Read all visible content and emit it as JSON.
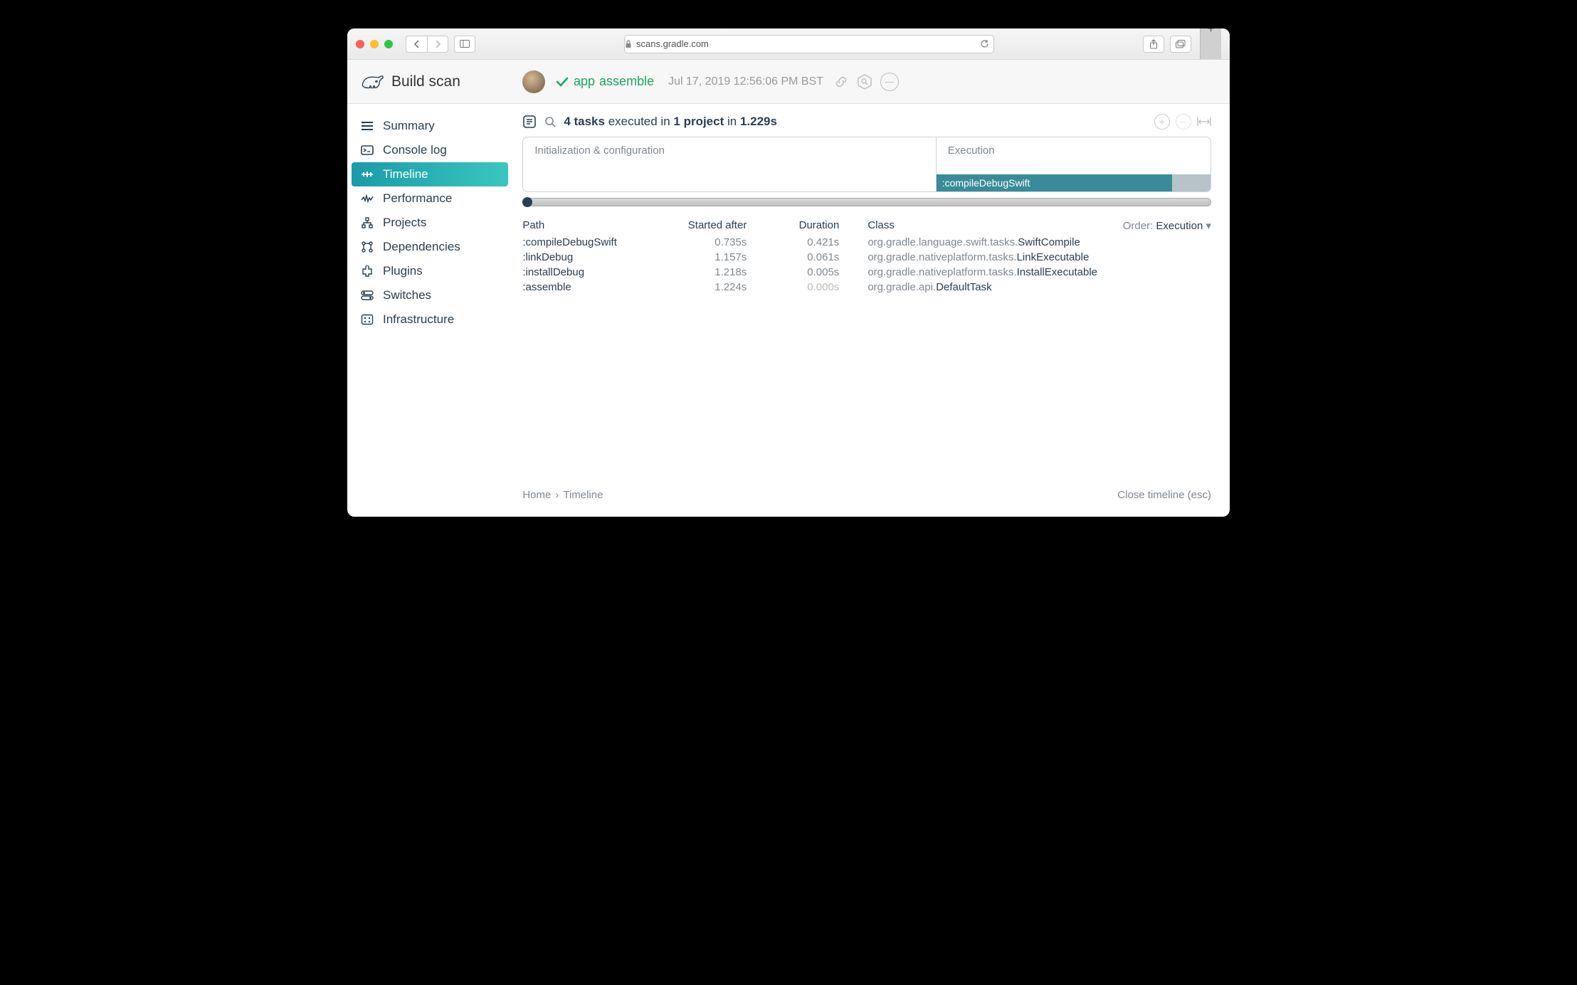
{
  "browser": {
    "url": "scans.gradle.com"
  },
  "brand": "Build scan",
  "header": {
    "project": "app",
    "task": "assemble",
    "timestamp": "Jul 17, 2019 12:56:06 PM BST"
  },
  "sidebar": {
    "items": [
      {
        "label": "Summary"
      },
      {
        "label": "Console log"
      },
      {
        "label": "Timeline"
      },
      {
        "label": "Performance"
      },
      {
        "label": "Projects"
      },
      {
        "label": "Dependencies"
      },
      {
        "label": "Plugins"
      },
      {
        "label": "Switches"
      },
      {
        "label": "Infrastructure"
      }
    ],
    "active_index": 2
  },
  "timeline": {
    "summary": {
      "tasks": "4 tasks",
      "mid": " executed in ",
      "projects": "1 project",
      "mid2": " in ",
      "duration": "1.229s"
    },
    "phases": {
      "left": "Initialization & configuration",
      "right": "Execution",
      "bar_label": ":compileDebugSwift"
    },
    "columns": {
      "path": "Path",
      "start": "Started after",
      "duration": "Duration",
      "class": "Class",
      "order_label": "Order:",
      "order_value": "Execution"
    },
    "rows": [
      {
        "path": ":compileDebugSwift",
        "start": "0.735s",
        "duration": "0.421s",
        "class_prefix": "org.gradle.language.swift.tasks.",
        "class_name": "SwiftCompile"
      },
      {
        "path": ":linkDebug",
        "start": "1.157s",
        "duration": "0.061s",
        "class_prefix": "org.gradle.nativeplatform.tasks.",
        "class_name": "LinkExecutable"
      },
      {
        "path": ":installDebug",
        "start": "1.218s",
        "duration": "0.005s",
        "class_prefix": "org.gradle.nativeplatform.tasks.",
        "class_name": "InstallExecutable"
      },
      {
        "path": ":assemble",
        "start": "1.224s",
        "duration": "0.000s",
        "class_prefix": "org.gradle.api.",
        "class_name": "DefaultTask"
      }
    ]
  },
  "footer": {
    "home": "Home",
    "page": "Timeline",
    "close": "Close timeline (esc)"
  }
}
